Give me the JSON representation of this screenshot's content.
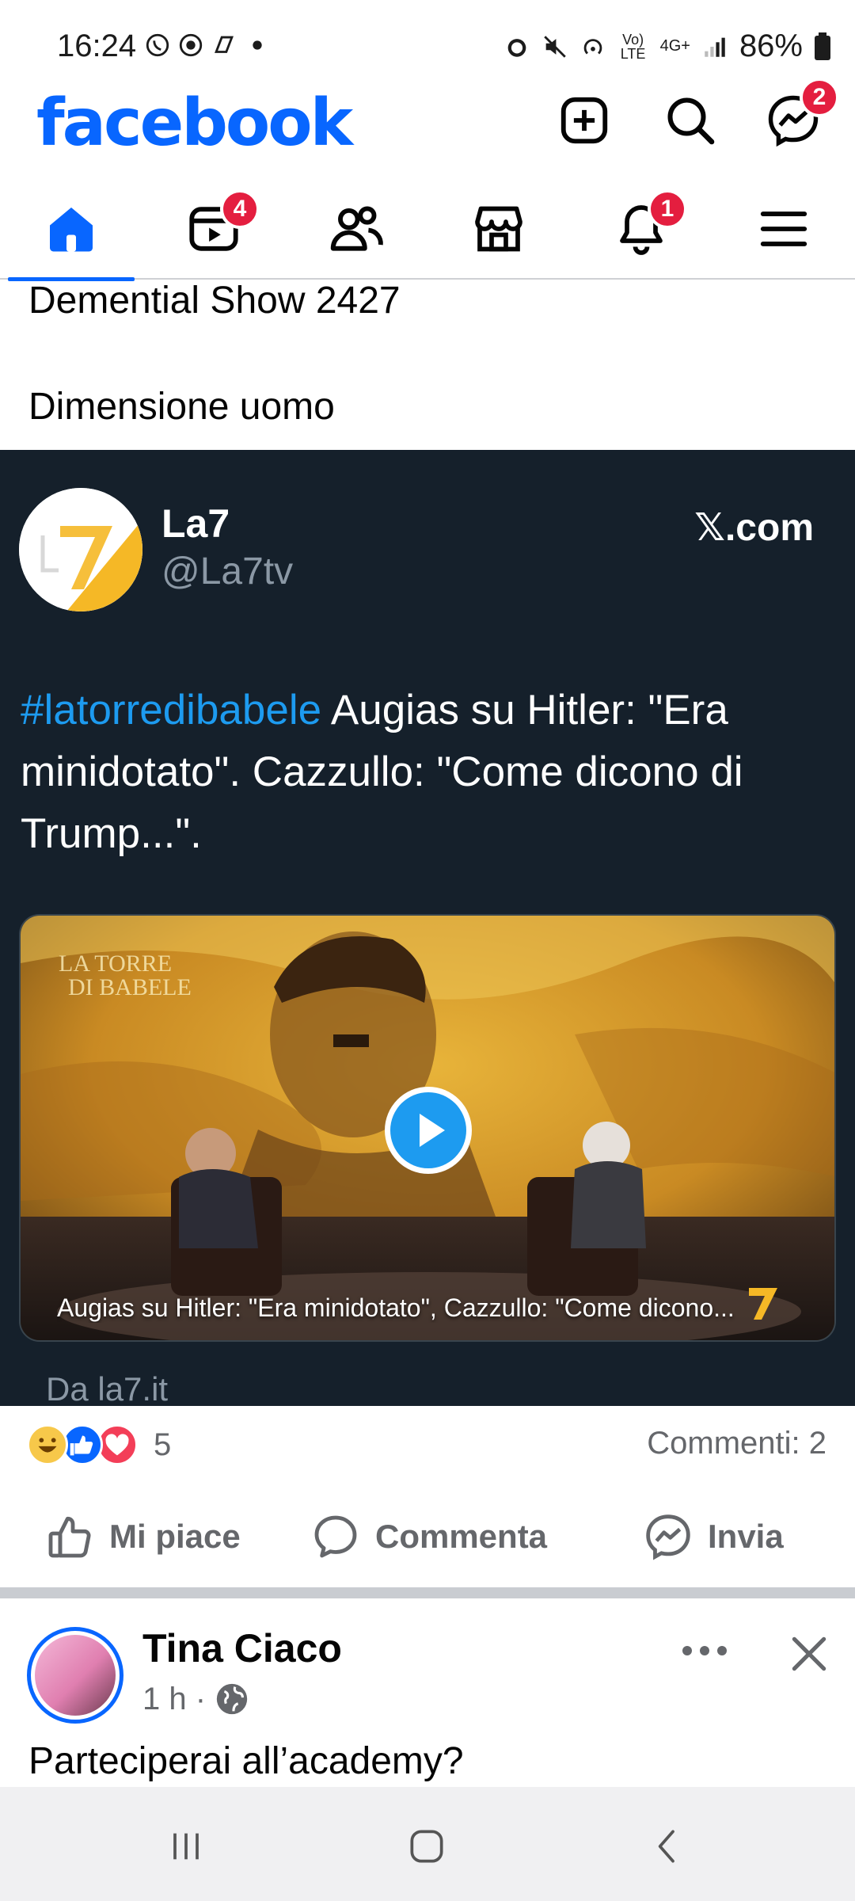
{
  "status_bar": {
    "time": "16:24",
    "battery": "86%",
    "network": "4G+",
    "volte": "Vo) LTE"
  },
  "header": {
    "logo": "facebook",
    "messenger_badge": "2"
  },
  "nav": {
    "video_badge": "4",
    "notifications_badge": "1"
  },
  "prev_post": {
    "line1": "Demential Show 2427",
    "line2": "Dimensione uomo"
  },
  "tweet": {
    "name": "La7",
    "handle": "@La7tv",
    "source": "𝕏.com",
    "hashtag": "#latorredibabele",
    "text": " Augias su Hitler: \"Era minidotato\". Cazzullo: \"Come dicono di Trump...\".",
    "media_caption": "Augias su Hitler: \"Era minidotato\", Cazzullo: \"Come dicono...",
    "from": "Da la7.it"
  },
  "reactions": {
    "count": "5",
    "comments": "Commenti: 2"
  },
  "actions": {
    "like": "Mi piace",
    "comment": "Commenta",
    "send": "Invia"
  },
  "next_post": {
    "name": "Tina Ciaco",
    "time": "1 h ·",
    "text": "Parteciperai all’academy?"
  },
  "colors": {
    "brand": "#0866ff",
    "tweet_bg": "#15202b",
    "badge": "#e41e3f",
    "hashtag": "#1d9bf0"
  }
}
